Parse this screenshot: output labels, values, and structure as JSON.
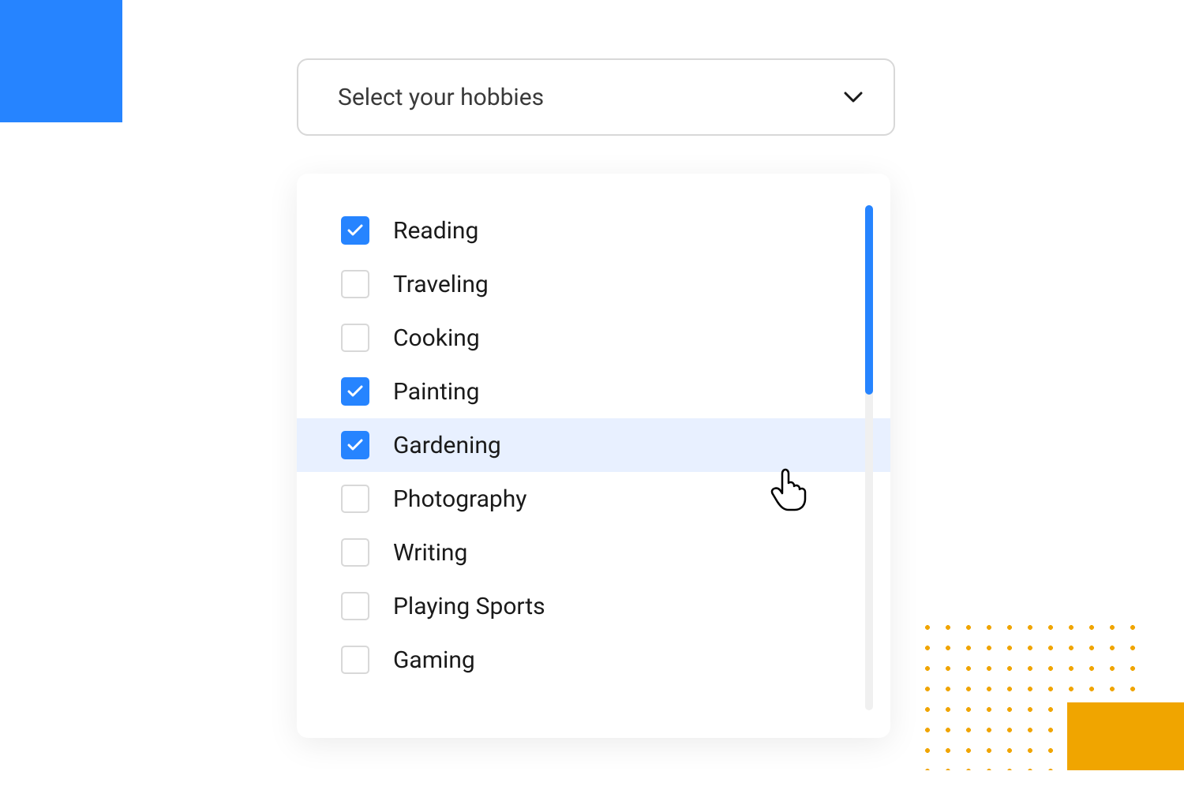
{
  "select": {
    "placeholder": "Select your hobbies",
    "options": [
      {
        "label": "Reading",
        "checked": true,
        "hovered": false
      },
      {
        "label": "Traveling",
        "checked": false,
        "hovered": false
      },
      {
        "label": "Cooking",
        "checked": false,
        "hovered": false
      },
      {
        "label": "Painting",
        "checked": true,
        "hovered": false
      },
      {
        "label": "Gardening",
        "checked": true,
        "hovered": true
      },
      {
        "label": "Photography",
        "checked": false,
        "hovered": false
      },
      {
        "label": "Writing",
        "checked": false,
        "hovered": false
      },
      {
        "label": "Playing Sports",
        "checked": false,
        "hovered": false
      },
      {
        "label": "Gaming",
        "checked": false,
        "hovered": false
      }
    ]
  },
  "colors": {
    "accent": "#2684FF",
    "orange": "#f0a500"
  }
}
